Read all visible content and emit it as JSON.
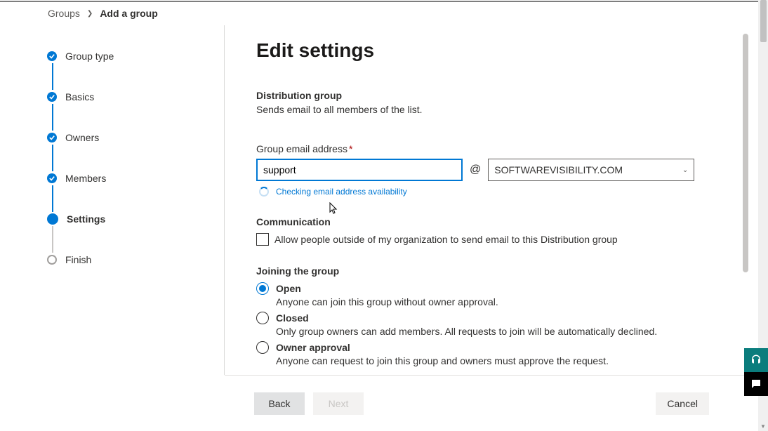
{
  "breadcrumb": {
    "parent": "Groups",
    "current": "Add a group"
  },
  "steps": {
    "type": "Group type",
    "basics": "Basics",
    "owners": "Owners",
    "members": "Members",
    "settings": "Settings",
    "finish": "Finish"
  },
  "page": {
    "title": "Edit settings",
    "subhead": "Distribution group",
    "subdesc": "Sends email to all members of the list."
  },
  "email": {
    "label": "Group email address",
    "value": "support",
    "at": "@",
    "domain": "SOFTWAREVISIBILITY.COM",
    "checking": "Checking email address availability"
  },
  "comm": {
    "head": "Communication",
    "allow": "Allow people outside of my organization to send email to this Distribution group"
  },
  "join": {
    "head": "Joining the group",
    "open": {
      "label": "Open",
      "desc": "Anyone can join this group without owner approval."
    },
    "closed": {
      "label": "Closed",
      "desc": "Only group owners can add members. All requests to join will be automatically declined."
    },
    "approval": {
      "label": "Owner approval",
      "desc": "Anyone can request to join this group and owners must approve the request."
    }
  },
  "footer": {
    "back": "Back",
    "next": "Next",
    "cancel": "Cancel"
  },
  "icons": {
    "headset": "headset-icon",
    "chat": "chat-icon"
  }
}
